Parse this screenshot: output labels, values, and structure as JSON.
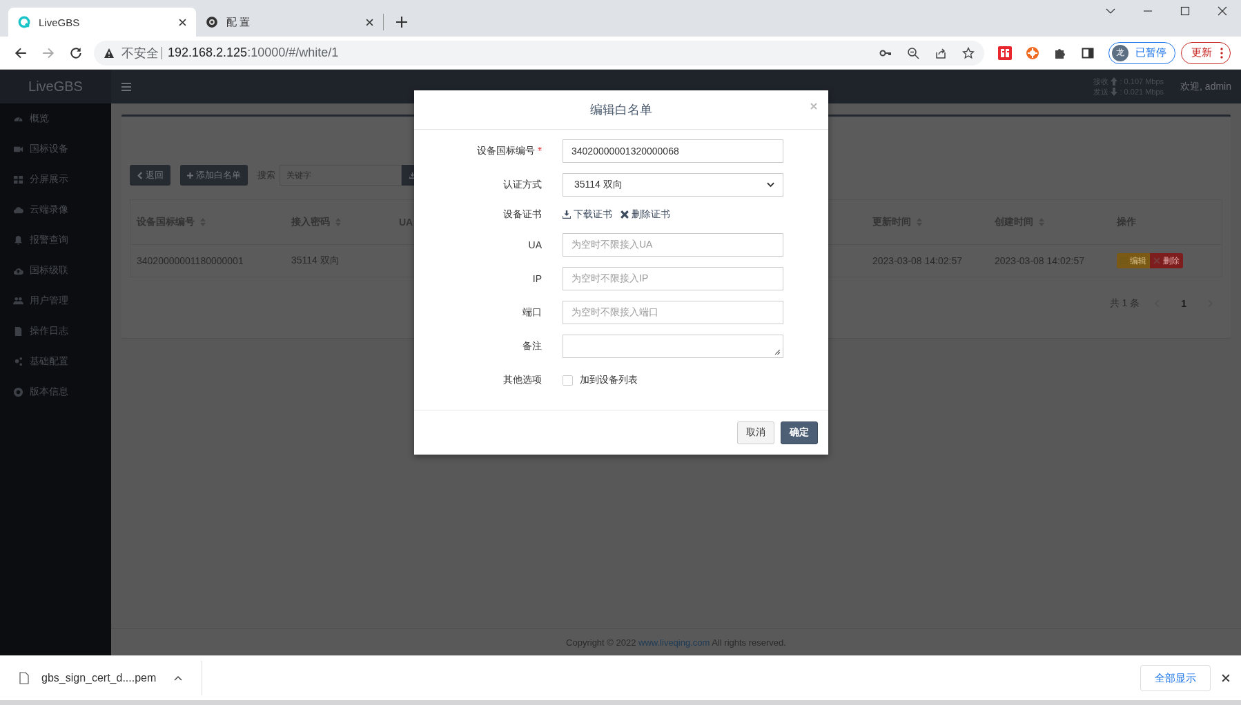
{
  "browser": {
    "tabs": [
      {
        "title": "LiveGBS",
        "selected": true
      },
      {
        "title": "配 置",
        "selected": false
      }
    ],
    "security": "不安全",
    "url_host": "192.168.2.125",
    "url_rest": ":10000/#/white/1",
    "profile_initial": "龙",
    "profile_status": "已暂停",
    "update_button": "更新"
  },
  "header": {
    "logo": "LiveGBS",
    "rx_label": "接收",
    "rx_value": ":  0.107 Mbps",
    "tx_label": "发送",
    "tx_value": ":  0.021 Mbps",
    "welcome": "欢迎, admin"
  },
  "sidebar": {
    "items": [
      "概览",
      "国标设备",
      "分屏展示",
      "云端录像",
      "报警查询",
      "国标级联",
      "用户管理",
      "操作日志",
      "基础配置",
      "版本信息"
    ]
  },
  "toolbar": {
    "back_button": "返回",
    "add_button": "添加白名单",
    "search_label": "搜索",
    "search_placeholder": "关键字"
  },
  "table": {
    "columns": [
      {
        "label": "设备国标编号",
        "sortable": true
      },
      {
        "label": "接入密码",
        "sortable": true
      },
      {
        "label": "UA",
        "sortable": false
      },
      {
        "label": "更新时间",
        "sortable": true
      },
      {
        "label": "创建时间",
        "sortable": true
      },
      {
        "label": "操作",
        "sortable": false
      }
    ],
    "rows": [
      {
        "cells": [
          "34020000001180000001",
          "35114 双向",
          "",
          "2023-03-08 14:02:57",
          "2023-03-08 14:02:57"
        ],
        "edit_button": "编辑",
        "delete_button": "删除"
      }
    ]
  },
  "pagination": {
    "total": "共 1 条",
    "pages": [
      {
        "label": "1",
        "selected": true
      }
    ]
  },
  "modal": {
    "title": "编辑白名单",
    "fields": [
      {
        "kind": "text",
        "label": "设备国标编号",
        "required": true,
        "value": "34020000001320000068"
      },
      {
        "kind": "select",
        "label": "认证方式",
        "required": false,
        "value": "35114 双向"
      },
      {
        "kind": "links",
        "label": "设备证书",
        "required": false,
        "links": [
          "下载证书",
          "删除证书"
        ]
      },
      {
        "kind": "text",
        "label": "UA",
        "required": false,
        "placeholder": "为空时不限接入UA"
      },
      {
        "kind": "text",
        "label": "IP",
        "required": false,
        "placeholder": "为空时不限接入IP"
      },
      {
        "kind": "text",
        "label": "端口",
        "required": false,
        "placeholder": "为空时不限接入端口"
      },
      {
        "kind": "textarea",
        "label": "备注",
        "required": false
      },
      {
        "kind": "checkbox",
        "label": "其他选项",
        "required": false,
        "option": "加到设备列表",
        "checked": false
      }
    ],
    "cancel_button": "取消",
    "ok_button": "确定"
  },
  "footer": {
    "copyright": "Copyright © 2022",
    "link": "www.liveqing.com",
    "rest": "All rights reserved."
  },
  "download_bar": {
    "file": "gbs_sign_cert_d....pem",
    "show_all": "全部显示"
  }
}
